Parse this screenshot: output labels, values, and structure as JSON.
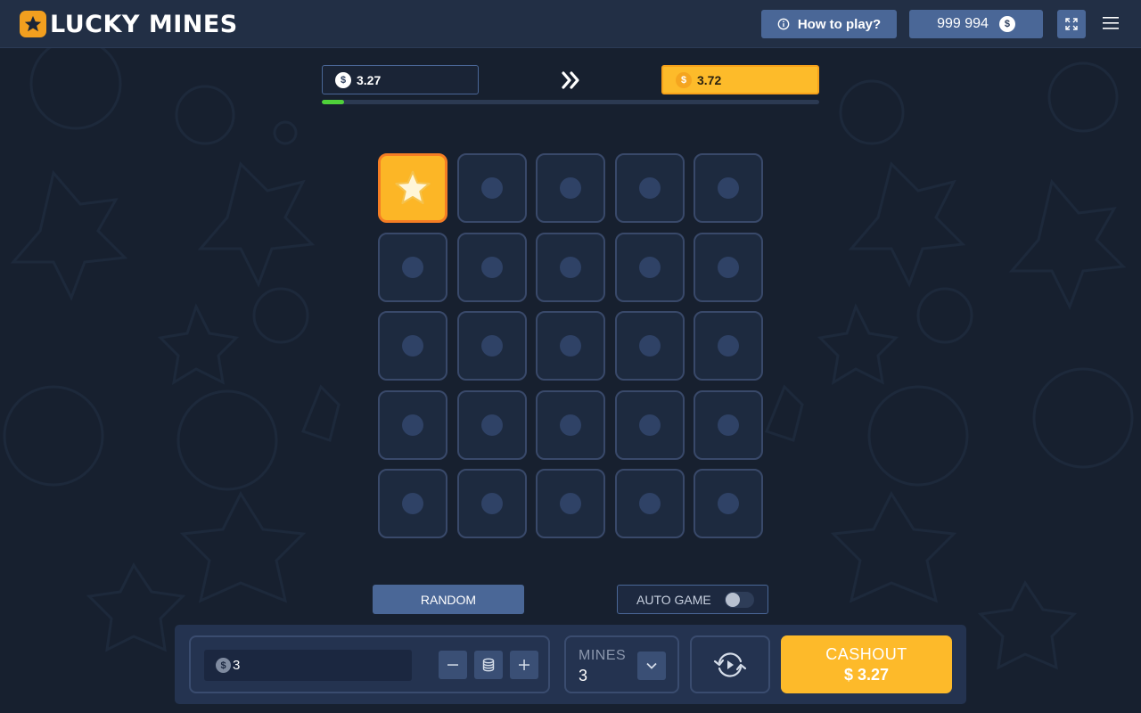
{
  "header": {
    "logo_text": "LUCKY MINES",
    "how_to_play_label": "How to play?",
    "balance": "999 994",
    "currency_symbol": "$"
  },
  "multipliers": {
    "current": "3.27",
    "next": "3.72",
    "progress": 0.045
  },
  "grid": {
    "rows": 5,
    "cols": 5,
    "revealed_cells": [
      0
    ]
  },
  "controls": {
    "random_label": "RANDOM",
    "auto_game_label": "AUTO GAME",
    "auto_game_enabled": false
  },
  "bet": {
    "value": "3",
    "minus_label": "−",
    "plus_label": "+"
  },
  "mines": {
    "label": "MINES",
    "value": "3"
  },
  "cashout": {
    "label": "CASHOUT",
    "amount": "$ 3.27"
  },
  "colors": {
    "background": "#17202f",
    "accent_gold": "#fdba2a",
    "accent_blue": "#4a6797",
    "progress_green": "#4fd13a"
  }
}
